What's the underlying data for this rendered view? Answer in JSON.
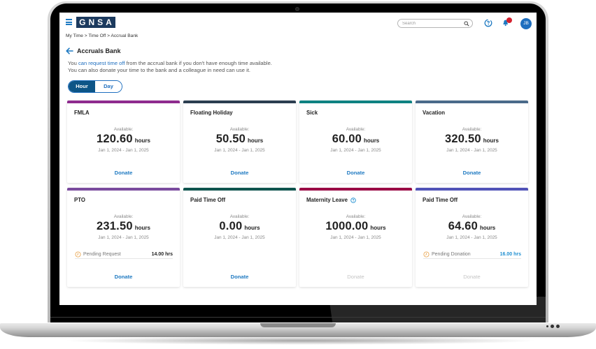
{
  "app": {
    "logo_text": "GNSA",
    "search_placeholder": "Search",
    "user_initials": "JB"
  },
  "breadcrumb": [
    "My Time",
    "Time Off",
    "Accrual Bank"
  ],
  "breadcrumb_separator": ">",
  "page": {
    "title": "Accruals Bank",
    "intro_prefix": "You ",
    "intro_link": "can request time off",
    "intro_suffix": " from the accrual bank if you don't have enough time available.",
    "intro_line2": "You can also donate your time to the bank and a colleague in need can use it."
  },
  "toggle": {
    "options": [
      "Hour",
      "Day"
    ],
    "selected": "Hour"
  },
  "labels": {
    "available": "Available:",
    "unit": "hours",
    "donate": "Donate"
  },
  "cards": [
    {
      "name": "FMLA",
      "value": "120.60",
      "dates": "Jan 1, 2024 - Jan 1, 2025",
      "color": "#8e2c8e",
      "donate_enabled": true
    },
    {
      "name": "Floating Holiday",
      "value": "50.50",
      "dates": "Jan 1, 2024 - Jan 1, 2025",
      "color": "#2c3e50",
      "donate_enabled": true
    },
    {
      "name": "Sick",
      "value": "60.00",
      "dates": "Jan 1, 2024 - Jan 1, 2025",
      "color": "#0e8282",
      "donate_enabled": true
    },
    {
      "name": "Vacation",
      "value": "320.50",
      "dates": "Jan 1, 2024 - Jan 1, 2025",
      "color": "#4a6a8a",
      "donate_enabled": true
    },
    {
      "name": "PTO",
      "value": "231.50",
      "dates": "Jan 1, 2024 - Jan 1, 2025",
      "color": "#7a4b9e",
      "donate_enabled": true,
      "pending": {
        "label": "Pending Request",
        "value": "14.00 hrs",
        "highlight": false
      }
    },
    {
      "name": "Paid Time Off",
      "value": "0.00",
      "dates": "Jan 1, 2024 - Jan 1, 2025",
      "color": "#0f544e",
      "donate_enabled": true
    },
    {
      "name": "Maternity Leave",
      "value": "1000.00",
      "dates": "Jan 1, 2024 - Jan 1, 2025",
      "color": "#9a0a45",
      "donate_enabled": false,
      "info_icon": true
    },
    {
      "name": "Paid Time Off",
      "value": "64.60",
      "dates": "Jan 1, 2024 - Jan 1, 2025",
      "color": "#5153b8",
      "donate_enabled": false,
      "pending": {
        "label": "Pending Donation",
        "value": "16.00 hrs",
        "highlight": true
      }
    }
  ],
  "colors": {
    "primary": "#1f6fbf",
    "toggle_active": "#0d5587",
    "logo_bg": "#1c3a5e",
    "notification_badge": "#d4212f",
    "pending_icon": "#e8a24a"
  },
  "icons": {
    "menu": "hamburger-icon",
    "search": "search-icon",
    "help": "help-icon",
    "notifications": "bell-icon",
    "back": "back-arrow-icon",
    "pending": "clock-icon",
    "info": "info-icon"
  }
}
